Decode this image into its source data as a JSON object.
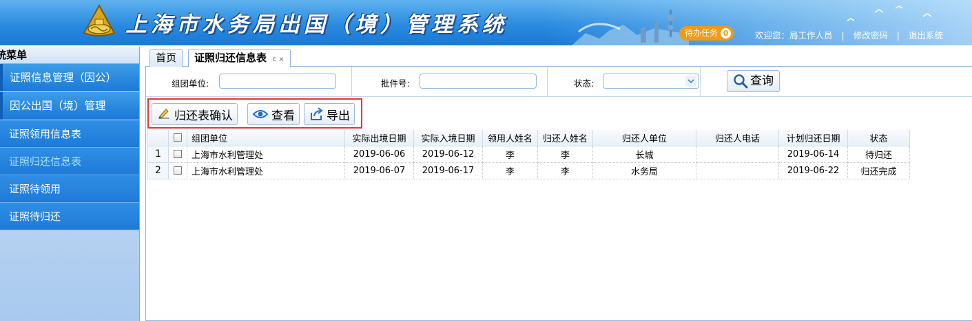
{
  "header": {
    "title": "上海市水务局出国（境）管理系统",
    "todo_label": "待办任务",
    "todo_count": "0",
    "welcome": "欢迎您：局工作人员",
    "change_password": "修改密码",
    "logout": "退出系统",
    "separator": "|"
  },
  "sidebar": {
    "title": "统菜单",
    "collapse_icon": "«",
    "groups": [
      {
        "label": "证照信息管理（因公）"
      },
      {
        "label": "因公出国（境）管理"
      }
    ],
    "items": [
      {
        "label": "证照领用信息表"
      },
      {
        "label": "证照归还信息表"
      },
      {
        "label": "证照待领用"
      },
      {
        "label": "证照待归还"
      }
    ]
  },
  "tabs": [
    {
      "label": "首页"
    },
    {
      "label": "证照归还信息表",
      "icons": "ꞇ ×"
    }
  ],
  "search": {
    "group_unit_label": "组团单位:",
    "group_unit_value": "",
    "batch_no_label": "批件号:",
    "batch_no_value": "",
    "status_label": "状态:",
    "status_value": "",
    "query_label": "查询"
  },
  "toolbar": {
    "confirm_label": "归还表确认",
    "view_label": "查看",
    "export_label": "导出"
  },
  "grid": {
    "columns": [
      "组团单位",
      "实际出境日期",
      "实际入境日期",
      "领用人姓名",
      "归还人姓名",
      "归还人单位",
      "归还人电话",
      "计划归还日期",
      "状态"
    ],
    "rows": [
      {
        "num": "1",
        "unit": "上海市水利管理处",
        "out_date": "2019-06-06",
        "in_date": "2019-06-12",
        "borrower": "李",
        "returner": "李",
        "returner_unit": "长城",
        "phone": "",
        "plan_date": "2019-06-14",
        "status": "待归还"
      },
      {
        "num": "2",
        "unit": "上海市水利管理处",
        "out_date": "2019-06-07",
        "in_date": "2019-06-17",
        "borrower": "李",
        "returner": "李",
        "returner_unit": "水务局",
        "phone": "",
        "plan_date": "2019-06-22",
        "status": "归还完成"
      }
    ]
  },
  "colors": {
    "header_blue": "#2a8be0",
    "todo_orange": "#f09a16",
    "sidebar_blue": "#1e7ad8",
    "highlight_red": "#e53535"
  }
}
